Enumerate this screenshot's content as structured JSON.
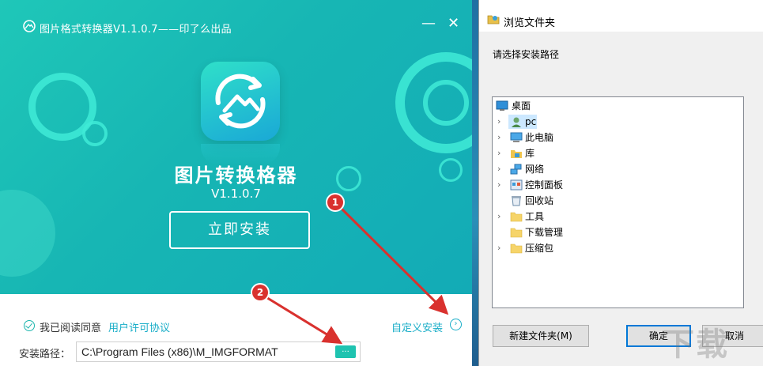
{
  "installer": {
    "title": "图片格式转换器V1.1.0.7——印了么出品",
    "minimize": "—",
    "close": "✕",
    "app_name": "图片转换格器",
    "version": "V1.1.0.7",
    "install_button": "立即安装",
    "agree_text": "我已阅读同意",
    "license_link": "用户许可协议",
    "custom_install": "自定义安装",
    "path_label": "安装路径：",
    "path_value": "C:\\Program Files (x86)\\M_IMGFORMAT",
    "browse_button": "...",
    "colors": {
      "accent": "#1bb5ad",
      "link": "#1aaec8"
    }
  },
  "annotations": {
    "marker1": "1",
    "marker2": "2"
  },
  "dialog": {
    "title": "浏览文件夹",
    "instruction": "请选择安装路径",
    "tree": [
      {
        "label": "桌面",
        "icon": "desktop-icon",
        "expandable": false
      },
      {
        "label": "pc",
        "icon": "user-icon",
        "expandable": true,
        "selected": true
      },
      {
        "label": "此电脑",
        "icon": "computer-icon",
        "expandable": true
      },
      {
        "label": "库",
        "icon": "library-icon",
        "expandable": true
      },
      {
        "label": "网络",
        "icon": "network-icon",
        "expandable": true
      },
      {
        "label": "控制面板",
        "icon": "control-panel-icon",
        "expandable": true
      },
      {
        "label": "回收站",
        "icon": "recycle-bin-icon",
        "expandable": false
      },
      {
        "label": "工具",
        "icon": "folder-icon",
        "expandable": true
      },
      {
        "label": "下载管理",
        "icon": "folder-icon",
        "expandable": false
      },
      {
        "label": "压缩包",
        "icon": "folder-icon",
        "expandable": true
      }
    ],
    "new_folder_button": "新建文件夹(M)",
    "ok_button": "确定",
    "cancel_button": "取消"
  },
  "watermark": "下载"
}
